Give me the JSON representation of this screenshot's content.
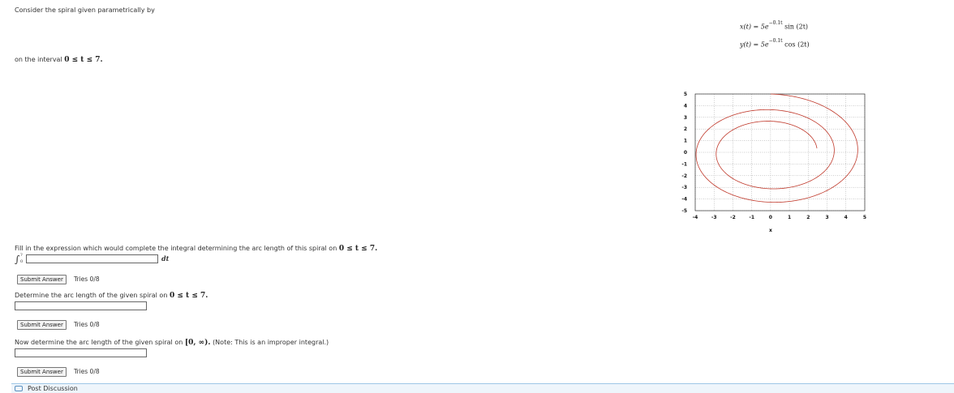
{
  "problem": {
    "intro": "Consider the spiral given parametrically by",
    "interval_prefix": "on the interval",
    "interval_math": "0 ≤ t ≤ 7.",
    "formula_x": {
      "lhs": "x(t) = 5e",
      "exp": "−0.1t",
      "rhs": "sin (2t)"
    },
    "formula_y": {
      "lhs": "y(t) = 5e",
      "exp": "−0.1t",
      "rhs": "cos (2t)"
    }
  },
  "questions": [
    {
      "prompt": "Fill in the expression which would complete the integral determining the arc length of this spiral on",
      "math": "0 ≤ t ≤ 7.",
      "integral_lower": "0",
      "integral_upper": "?",
      "integral_sign": "∫",
      "dt": "dt",
      "value": "",
      "button": "Submit Answer",
      "tries": "Tries 0/8"
    },
    {
      "prompt": "Determine the arc length of the given spiral on",
      "math": "0 ≤ t ≤ 7.",
      "value": "",
      "button": "Submit Answer",
      "tries": "Tries 0/8"
    },
    {
      "prompt": "Now determine the arc length of the given spiral on",
      "math": "[0, ∞).",
      "note": "(Note: This is an improper integral.)",
      "value": "",
      "button": "Submit Answer",
      "tries": "Tries 0/8"
    }
  ],
  "footer": {
    "label": "Post Discussion"
  },
  "chart_data": {
    "type": "line",
    "title": "",
    "xlabel": "x",
    "ylabel": "",
    "xlim": [
      -4,
      5
    ],
    "ylim": [
      -5,
      5
    ],
    "x_ticks": [
      "-4",
      "-3",
      "-2",
      "-1",
      "0",
      "1",
      "2",
      "3",
      "4",
      "5"
    ],
    "y_ticks": [
      "5",
      "4",
      "3",
      "2",
      "1",
      "0",
      "-1",
      "-2",
      "-3",
      "-4",
      "-5"
    ],
    "grid": true,
    "series": [
      {
        "parametric": {
          "x": "5e^(-0.1t) sin(2t)",
          "y": "5e^(-0.1t) cos(2t)"
        },
        "t_range": [
          0,
          7
        ],
        "color": "#c0392b"
      }
    ]
  }
}
